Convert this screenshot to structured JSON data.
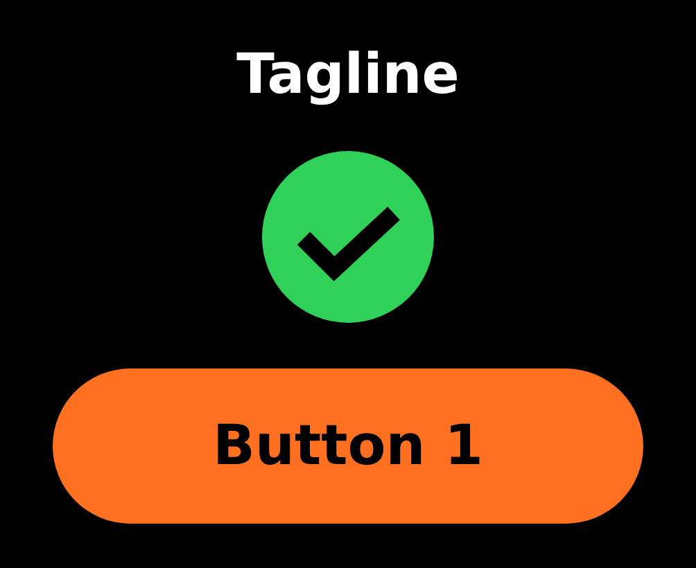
{
  "tagline": "Tagline",
  "status": {
    "kind": "success"
  },
  "buttons": [
    {
      "label": "Button 1"
    }
  ]
}
